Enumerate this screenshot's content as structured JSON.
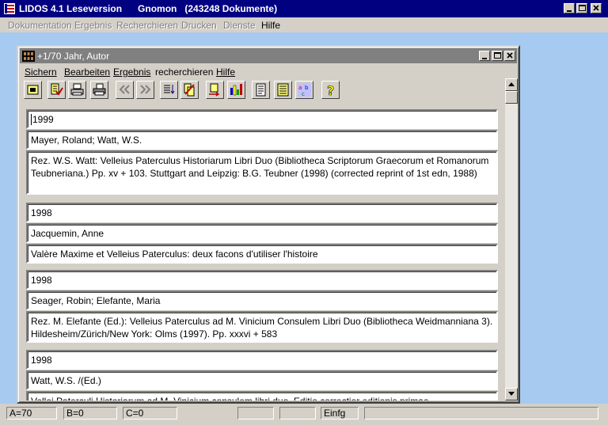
{
  "app": {
    "title": "LIDOS 4.1 Leseversion      Gnomon   (243248 Dokumente)",
    "menu": [
      "Dokumentation",
      "Ergebnis",
      "Recherchieren",
      "Drucken",
      "Dienste",
      "Hilfe"
    ]
  },
  "child": {
    "title": "+1/70  Jahr, Autor",
    "menu": [
      "Sichern",
      "Bearbeiten",
      "Ergebnis",
      "recherchieren",
      "Hilfe"
    ]
  },
  "toolbar_icons": [
    "window-icon",
    "checklist-icon",
    "printer-icon",
    "printer-setup-icon",
    "first-record-icon",
    "last-record-icon",
    "sort-list-icon",
    "delete-record-icon",
    "export-icon",
    "statistics-icon",
    "document-icon",
    "list-view-icon",
    "abc-index-icon",
    "help-icon"
  ],
  "records": [
    {
      "year": "1999",
      "author": "Mayer, Roland; Watt, W.S.",
      "title": "Rez. W.S. Watt: Velleius Paterculus Historiarum Libri Duo (Bibliotheca Scriptorum Graecorum et Romanorum Teubneriana.) Pp. xv + 103. Stuttgart and Leipzig: B.G. Teubner (1998) (corrected reprint of 1st edn, 1988)"
    },
    {
      "year": "1998",
      "author": "Jacquemin, Anne",
      "title": "Valère Maxime et Velleius Paterculus: deux facons d'utiliser l'histoire"
    },
    {
      "year": "1998",
      "author": "Seager, Robin; Elefante, Maria",
      "title": "Rez. M. Elefante (Ed.): Velleius Paterculus ad M. Vinicium Consulem Libri Duo (Bibliotheca Weidmanniana 3). Hildesheim/Zürich/New York: Olms (1997). Pp. xxxvi + 583"
    },
    {
      "year": "1998",
      "author": "Watt, W.S. /(Ed.)",
      "title": "Vellei Paterculi Historiarum ad M. Vinicium consulem libri duo. Editio correctior editionis primae"
    }
  ],
  "status": {
    "a": "A=70",
    "b": "B=0",
    "c": "C=0",
    "mode": "Einfg"
  },
  "colors": {
    "active_title": "#000080",
    "inactive_title": "#808080",
    "workspace": "#a6caf0",
    "face": "#d4d0c8"
  }
}
